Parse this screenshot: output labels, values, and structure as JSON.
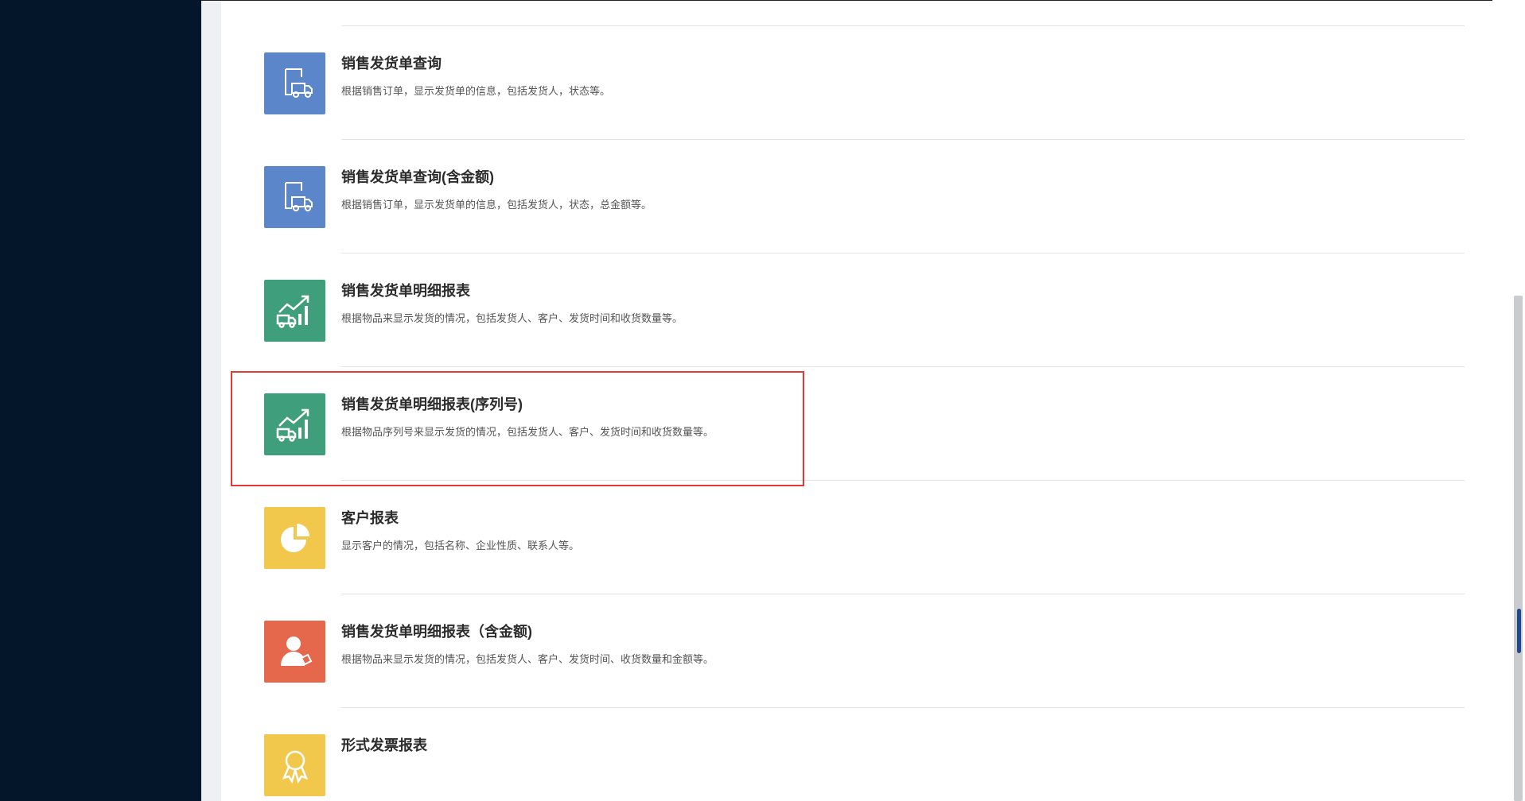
{
  "reports": [
    {
      "title": "销售发货单查询",
      "desc": "根据销售订单，显示发货单的信息，包括发货人，状态等。",
      "icon": "truck-document-icon",
      "color": "#5b86c9"
    },
    {
      "title": "销售发货单查询(含金额)",
      "desc": "根据销售订单，显示发货单的信息，包括发货人，状态，总金额等。",
      "icon": "truck-document-icon",
      "color": "#5b86c9"
    },
    {
      "title": "销售发货单明细报表",
      "desc": "根据物品来显示发货的情况，包括发货人、客户、发货时间和收货数量等。",
      "icon": "truck-growth-chart-icon",
      "color": "#3f9f7c"
    },
    {
      "title": "销售发货单明细报表(序列号)",
      "desc": "根据物品序列号来显示发货的情况，包括发货人、客户、发货时间和收货数量等。",
      "icon": "truck-growth-chart-icon",
      "color": "#3f9f7c"
    },
    {
      "title": "客户报表",
      "desc": "显示客户的情况，包括名称、企业性质、联系人等。",
      "icon": "pie-chart-icon",
      "color": "#f2c84c"
    },
    {
      "title": "销售发货单明细报表（含金额)",
      "desc": "根据物品来显示发货的情况，包括发货人、客户、发货时间、收货数量和金额等。",
      "icon": "user-tag-icon",
      "color": "#e5684c"
    },
    {
      "title": "形式发票报表",
      "desc": "",
      "icon": "award-badge-icon",
      "color": "#f2c84c"
    }
  ],
  "highlighted_index": 3,
  "colors": {
    "sidebar": "#03162a",
    "highlight_border": "#e53935"
  }
}
